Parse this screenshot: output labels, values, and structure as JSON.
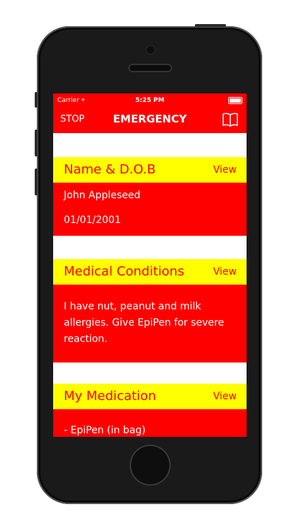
{
  "status_bar": {
    "carrier": "Carrier",
    "time": "5:25 PM"
  },
  "nav": {
    "left_label": "STOP",
    "title": "EMERGENCY",
    "right_icon": "book-icon"
  },
  "sections": [
    {
      "title": "Name & D.O.B",
      "action": "View",
      "lines": [
        "John Appleseed",
        "01/01/2001"
      ]
    },
    {
      "title": "Medical Conditions",
      "action": "View",
      "lines": [
        "I have nut, peanut and milk allergies. Give EpiPen for severe reaction."
      ]
    },
    {
      "title": "My Medication",
      "action": "View",
      "lines": [
        "- EpiPen (in bag)"
      ]
    }
  ],
  "colors": {
    "nav": "#ff0000",
    "header": "#ffff00",
    "body": "#ff0000"
  }
}
